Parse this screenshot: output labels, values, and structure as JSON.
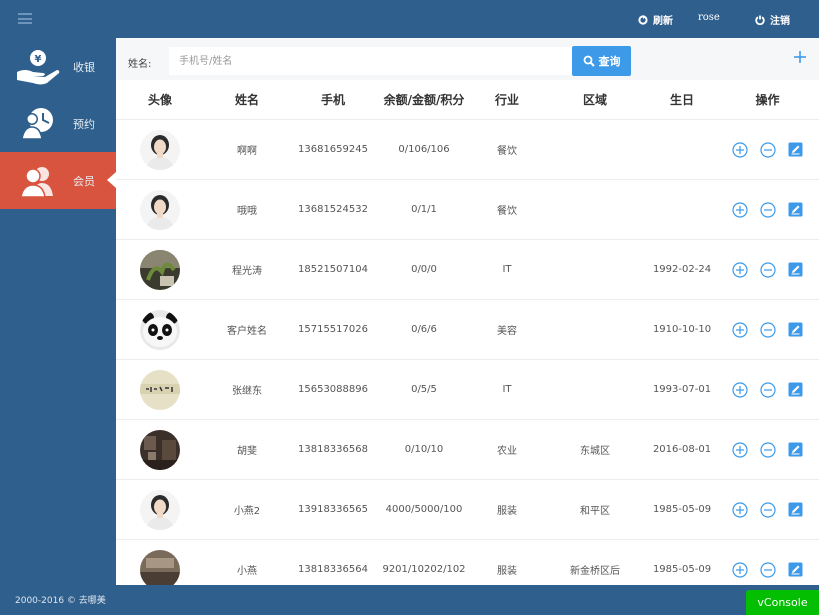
{
  "topbar": {
    "refresh_label": "刷新",
    "username": "rose",
    "logout_label": "注销"
  },
  "sidebar": {
    "items": [
      {
        "label": "收银",
        "icon": "cash-hand-icon"
      },
      {
        "label": "预约",
        "icon": "appointment-icon"
      },
      {
        "label": "会员",
        "icon": "members-icon",
        "active": true
      }
    ]
  },
  "search": {
    "label": "姓名:",
    "placeholder": "手机号/姓名",
    "button_label": "查询"
  },
  "table": {
    "headers": [
      "头像",
      "姓名",
      "手机",
      "余额/金额/积分",
      "行业",
      "区域",
      "生日",
      "操作"
    ],
    "rows": [
      {
        "avatar": "woman",
        "name": "啊啊",
        "phone": "13681659245",
        "balance": "0/106/106",
        "industry": "餐饮",
        "area": "",
        "birthday": ""
      },
      {
        "avatar": "woman",
        "name": "哦哦",
        "phone": "13681524532",
        "balance": "0/1/1",
        "industry": "餐饮",
        "area": "",
        "birthday": ""
      },
      {
        "avatar": "plant",
        "name": "程光涛",
        "phone": "18521507104",
        "balance": "0/0/0",
        "industry": "IT",
        "area": "",
        "birthday": "1992-02-24"
      },
      {
        "avatar": "panda",
        "name": "客户姓名",
        "phone": "15715517026",
        "balance": "0/6/6",
        "industry": "美容",
        "area": "",
        "birthday": "1910-10-10"
      },
      {
        "avatar": "calligraphy",
        "name": "张继东",
        "phone": "15653088896",
        "balance": "0/5/5",
        "industry": "IT",
        "area": "",
        "birthday": "1993-07-01"
      },
      {
        "avatar": "room",
        "name": "胡斐",
        "phone": "13818336568",
        "balance": "0/10/10",
        "industry": "农业",
        "area": "东城区",
        "birthday": "2016-08-01"
      },
      {
        "avatar": "woman",
        "name": "小燕2",
        "phone": "13918336565",
        "balance": "4000/5000/100",
        "industry": "服装",
        "area": "和平区",
        "birthday": "1985-05-09"
      },
      {
        "avatar": "room2",
        "name": "小燕",
        "phone": "13818336564",
        "balance": "9201/10202/102",
        "industry": "服装",
        "area": "新金桥区后",
        "birthday": "1985-05-09"
      }
    ]
  },
  "footer": {
    "copyright": "2000-2016 © 去哪美",
    "vconsole": "vConsole"
  },
  "colors": {
    "primary": "#2f5f8c",
    "accent": "#3d9ae8",
    "active": "#d9543f",
    "vconsole": "#04be02"
  }
}
